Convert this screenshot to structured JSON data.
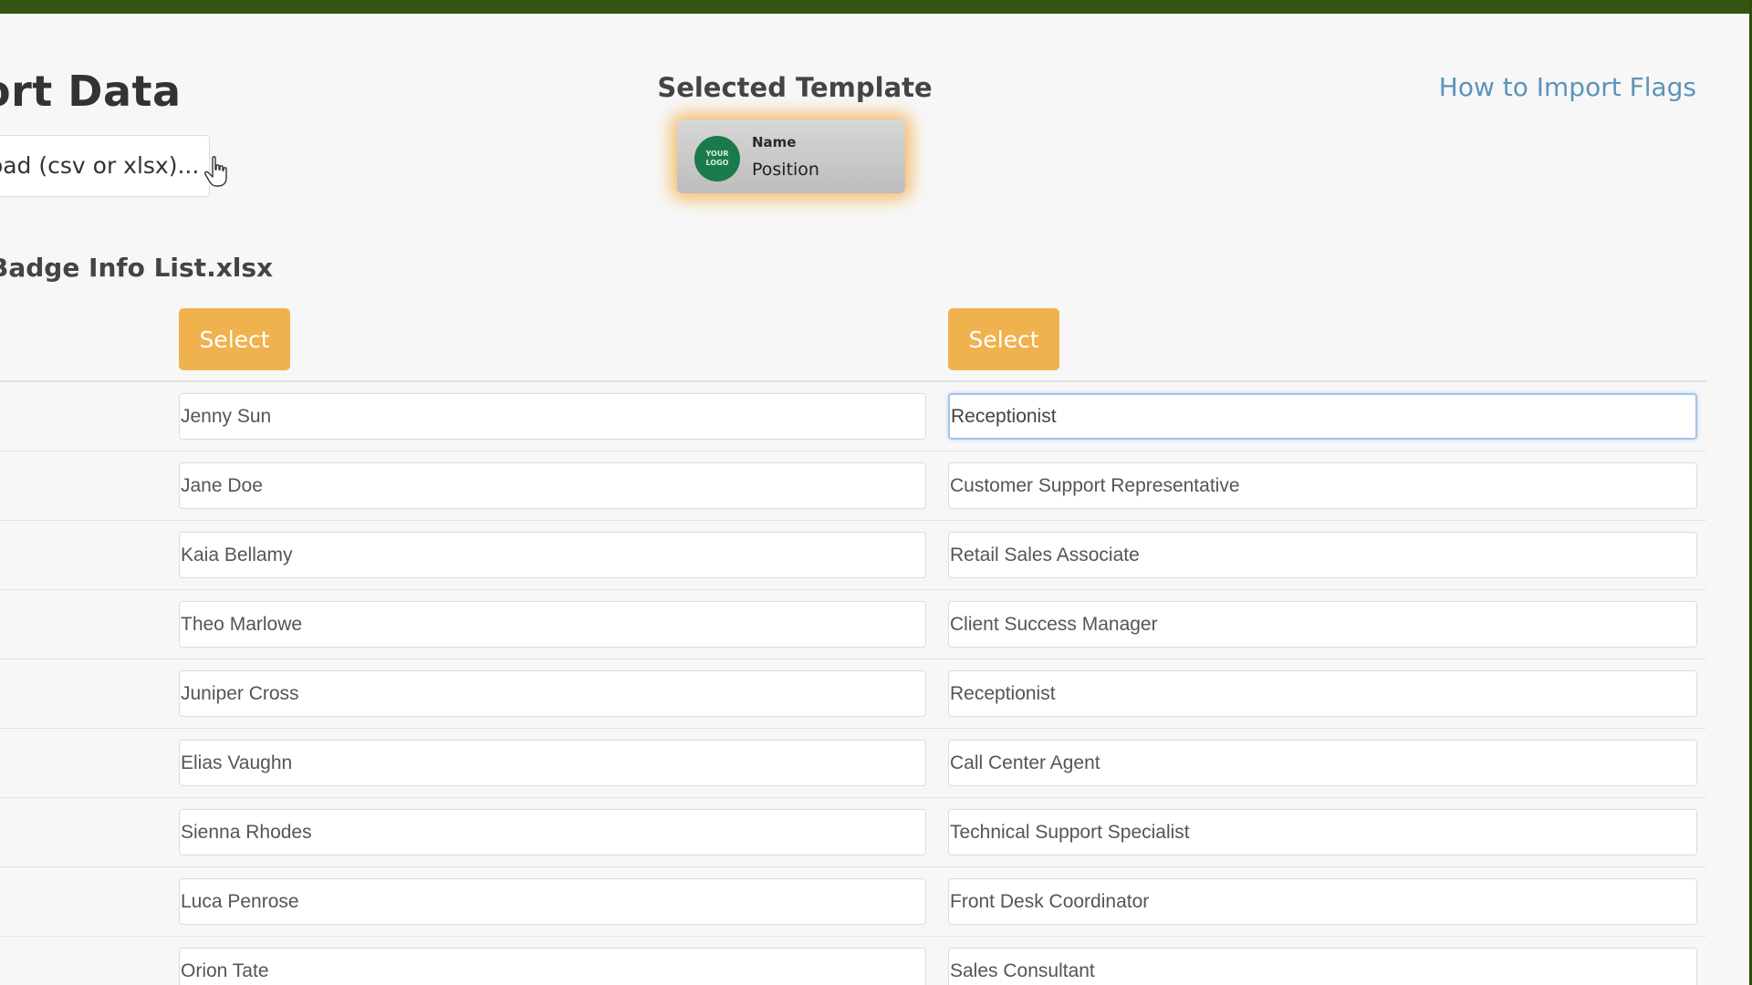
{
  "page": {
    "title": "ort Data",
    "upload_label": "load (csv or xlsx)...",
    "help_link": "How to Import Flags",
    "file_name": "Badge Info List.xlsx"
  },
  "template": {
    "heading": "Selected Template",
    "logo_text": "YOUR LOGO",
    "name_label": "Name",
    "position_label": "Position",
    "glow_color": "#f5a532"
  },
  "columns": {
    "select_label_1": "Select",
    "select_label_2": "Select",
    "button_color": "#f0b24e"
  },
  "rows": [
    {
      "name": "Jenny Sun",
      "position": "Receptionist"
    },
    {
      "name": "Jane Doe",
      "position": "Customer Support Representative"
    },
    {
      "name": "Kaia Bellamy",
      "position": "Retail Sales Associate"
    },
    {
      "name": "Theo Marlowe",
      "position": "Client Success Manager"
    },
    {
      "name": "Juniper Cross",
      "position": "Receptionist"
    },
    {
      "name": "Elias Vaughn",
      "position": "Call Center Agent"
    },
    {
      "name": "Sienna Rhodes",
      "position": "Technical Support Specialist"
    },
    {
      "name": "Luca Penrose",
      "position": "Front Desk Coordinator"
    },
    {
      "name": "Orion Tate",
      "position": "Sales Consultant"
    }
  ],
  "focused_field": "rows.0.position",
  "colors": {
    "link": "#5b94b8",
    "frame": "#3b5a10",
    "focus_border": "#9ec6ea"
  }
}
